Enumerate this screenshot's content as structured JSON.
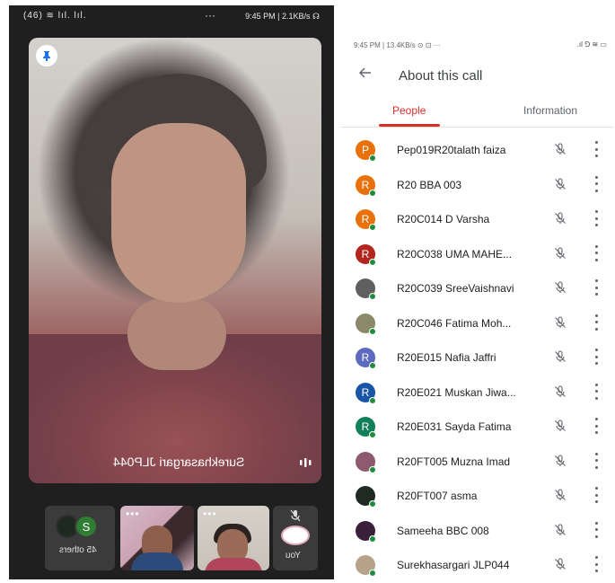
{
  "left_call": {
    "status_bar_left": "(46) ≋ lıl. lıl.",
    "status_bar_dots": "···",
    "status_bar_right": "9:45 PM | 2.1KB/s ☊",
    "pinned_speaker_label": "Surekhasargari JLP044",
    "others_count_label": "45 others",
    "others_avatar_letter": "S",
    "tile_more": "•••",
    "self_label": "You"
  },
  "about_call": {
    "status_bar_left": "9:45 PM | 13.4KB/s ⊙ ⊡ ···",
    "status_bar_right": ".ıl ⅁ ≋ ▭",
    "title": "About this call",
    "tabs": [
      {
        "label": "People",
        "active": true
      },
      {
        "label": "Information",
        "active": false
      }
    ],
    "people": [
      {
        "name": "Pep019R20talath faiza",
        "initial": "P",
        "color": "#e8710a",
        "photo": false
      },
      {
        "name": "R20 BBA 003",
        "initial": "R",
        "color": "#e8710a",
        "photo": false
      },
      {
        "name": "R20C014 D Varsha",
        "initial": "R",
        "color": "#e8710a",
        "photo": false
      },
      {
        "name": "R20C038 UMA MAHE...",
        "initial": "R",
        "color": "#b3261e",
        "photo": false
      },
      {
        "name": "R20C039 SreeVaishnavi",
        "initial": "",
        "color": "#5f5f5f",
        "photo": true
      },
      {
        "name": "R20C046 Fatima Moh...",
        "initial": "",
        "color": "#8a8a6a",
        "photo": true
      },
      {
        "name": "R20E015 Nafia Jaffri",
        "initial": "R",
        "color": "#5c6bc0",
        "photo": false
      },
      {
        "name": "R20E021 Muskan Jiwa...",
        "initial": "R",
        "color": "#1a56a7",
        "photo": false
      },
      {
        "name": "R20E031 Sayda Fatima",
        "initial": "R",
        "color": "#12805c",
        "photo": false
      },
      {
        "name": "R20FT005 Muzna Imad",
        "initial": "",
        "color": "#8d5a6e",
        "photo": true
      },
      {
        "name": "R20FT007 asma",
        "initial": "",
        "color": "#1f2a24",
        "photo": true
      },
      {
        "name": "Sameeha BBC 008",
        "initial": "",
        "color": "#3a1f3a",
        "photo": true
      },
      {
        "name": "Surekhasargari JLP044",
        "initial": "",
        "color": "#b7a28a",
        "photo": true
      }
    ]
  },
  "colors": {
    "accent_red": "#d93025",
    "presence_green": "#1e8e3e",
    "call_background": "#1f1f1f"
  }
}
